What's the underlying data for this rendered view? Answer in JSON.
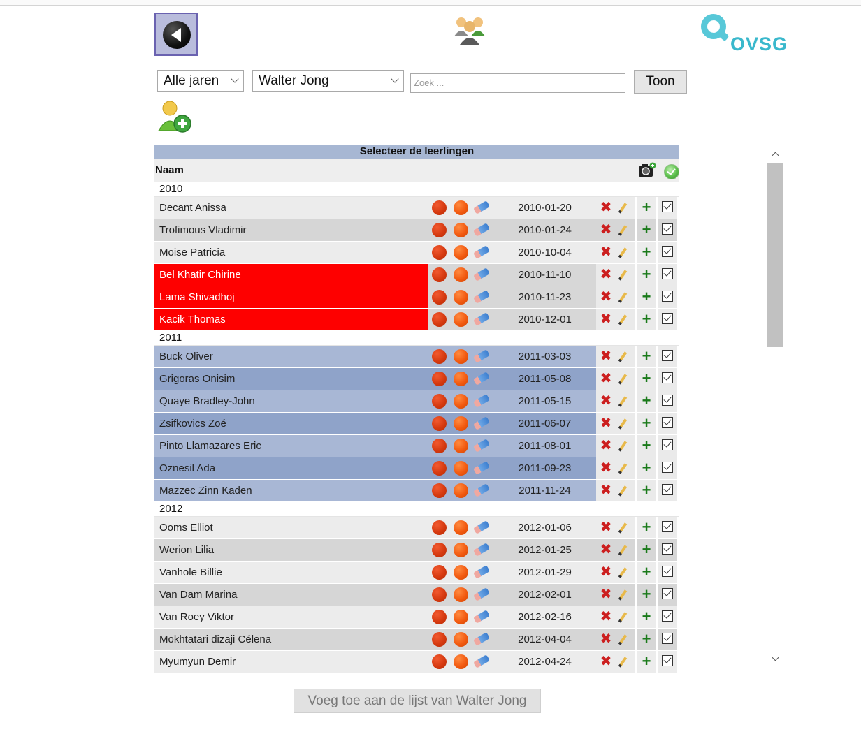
{
  "toolbar": {
    "back_icon": "back-arrow-icon",
    "group_icon": "group-people-icon",
    "logo_text": "OVSG"
  },
  "filters": {
    "year_select": "Alle jaren",
    "teacher_select": "Walter Jong",
    "search_placeholder": "Zoek ...",
    "show_button": "Toon"
  },
  "table": {
    "title": "Selecteer de leerlingen",
    "name_header": "Naam",
    "groups": [
      {
        "year": "2010",
        "rows": [
          {
            "name": "Decant Anissa",
            "date": "2010-01-20",
            "style": "light"
          },
          {
            "name": "Trofimous Vladimir",
            "date": "2010-01-24",
            "style": "mid"
          },
          {
            "name": "Moise Patricia",
            "date": "2010-10-04",
            "style": "light"
          },
          {
            "name": "Bel Khatir Chirine",
            "date": "2010-11-10",
            "style": "red"
          },
          {
            "name": "Lama Shivadhoj",
            "date": "2010-11-23",
            "style": "red"
          },
          {
            "name": "Kacik Thomas",
            "date": "2010-12-01",
            "style": "red"
          }
        ]
      },
      {
        "year": "2011",
        "rows": [
          {
            "name": "Buck Oliver",
            "date": "2011-03-03",
            "style": "blue1"
          },
          {
            "name": "Grigoras Onisim",
            "date": "2011-05-08",
            "style": "blue2"
          },
          {
            "name": "Quaye Bradley-John",
            "date": "2011-05-15",
            "style": "blue1"
          },
          {
            "name": "Zsifkovics Zoé",
            "date": "2011-06-07",
            "style": "blue2"
          },
          {
            "name": "Pinto Llamazares Eric",
            "date": "2011-08-01",
            "style": "blue1"
          },
          {
            "name": "Oznesil Ada",
            "date": "2011-09-23",
            "style": "blue2"
          },
          {
            "name": "Mazzec Zinn Kaden",
            "date": "2011-11-24",
            "style": "blue1"
          }
        ]
      },
      {
        "year": "2012",
        "rows": [
          {
            "name": "Ooms Elliot",
            "date": "2012-01-06",
            "style": "light"
          },
          {
            "name": "Werion Lilia",
            "date": "2012-01-25",
            "style": "mid"
          },
          {
            "name": "Vanhole Billie",
            "date": "2012-01-29",
            "style": "light"
          },
          {
            "name": "Van Dam Marina",
            "date": "2012-02-01",
            "style": "mid"
          },
          {
            "name": "Van Roey Viktor",
            "date": "2012-02-16",
            "style": "light"
          },
          {
            "name": "Mokhtatari dizaji Célena",
            "date": "2012-04-04",
            "style": "mid"
          },
          {
            "name": "Myumyun Demir",
            "date": "2012-04-24",
            "style": "light"
          }
        ]
      }
    ]
  },
  "submit_label": "Voeg toe aan de lijst van Walter Jong",
  "colors": {
    "light": "#ececec",
    "mid": "#d6d6d6",
    "red": "#fe0000",
    "blue1": "#a8b7d5",
    "blue2": "#8fa3c9",
    "header_bar": "#a7b7d3"
  }
}
